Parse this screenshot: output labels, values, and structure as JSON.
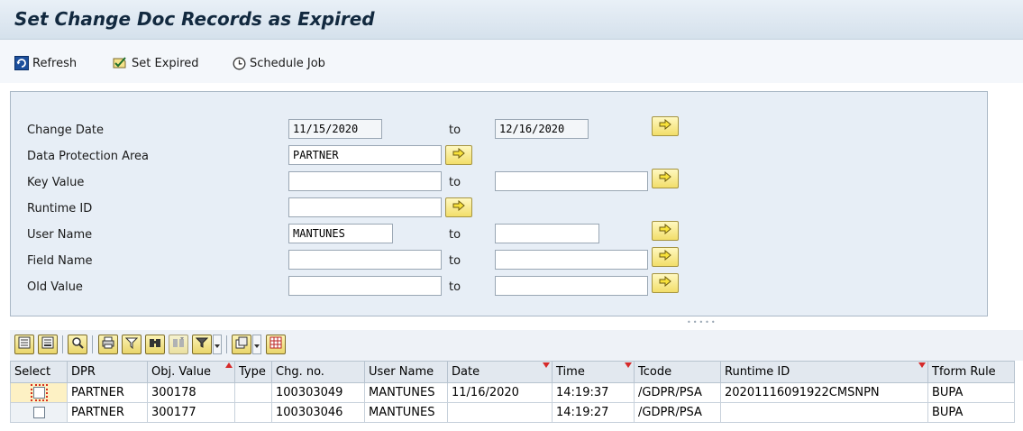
{
  "window": {
    "title": "Set Change Doc Records as Expired"
  },
  "toolbar": {
    "refresh_label": "Refresh",
    "set_expired_label": "Set Expired",
    "schedule_job_label": "Schedule Job"
  },
  "form": {
    "to_label": "to",
    "fields": [
      {
        "label": "Change Date",
        "from": "11/15/2020",
        "to": "12/16/2020"
      },
      {
        "label": "Data Protection Area",
        "from": "PARTNER"
      },
      {
        "label": "Key Value",
        "from": "",
        "to": ""
      },
      {
        "label": "Runtime ID",
        "from": ""
      },
      {
        "label": "User Name",
        "from": "MANTUNES",
        "to": ""
      },
      {
        "label": "Field Name",
        "from": "",
        "to": ""
      },
      {
        "label": "Old Value",
        "from": "",
        "to": ""
      }
    ]
  },
  "grid": {
    "columns": [
      "Select",
      "DPR",
      "Obj. Value",
      "Type",
      "Chg. no.",
      "User Name",
      "Date",
      "Time",
      "Tcode",
      "Runtime ID",
      "Tform Rule"
    ],
    "rows": [
      [
        "",
        "PARTNER",
        "300178",
        "",
        "100303049",
        "MANTUNES",
        "11/16/2020",
        "14:19:37",
        "/GDPR/PSA",
        "20201116091922CMSNPN",
        "BUPA"
      ],
      [
        "",
        "PARTNER",
        "300177",
        "",
        "100303046",
        "MANTUNES",
        "",
        "14:19:27",
        "/GDPR/PSA",
        "",
        "BUPA"
      ]
    ]
  },
  "colors": {
    "accent": "#12293f",
    "panel": "#e7eef6",
    "arrow_button": "#f2de6a",
    "sort_marker": "#d62a2a"
  },
  "icons": {
    "refresh": "refresh-icon",
    "set_expired": "set-expired-icon",
    "schedule_job": "clock-icon",
    "multiple_selection": "yellow-arrow-icon"
  }
}
